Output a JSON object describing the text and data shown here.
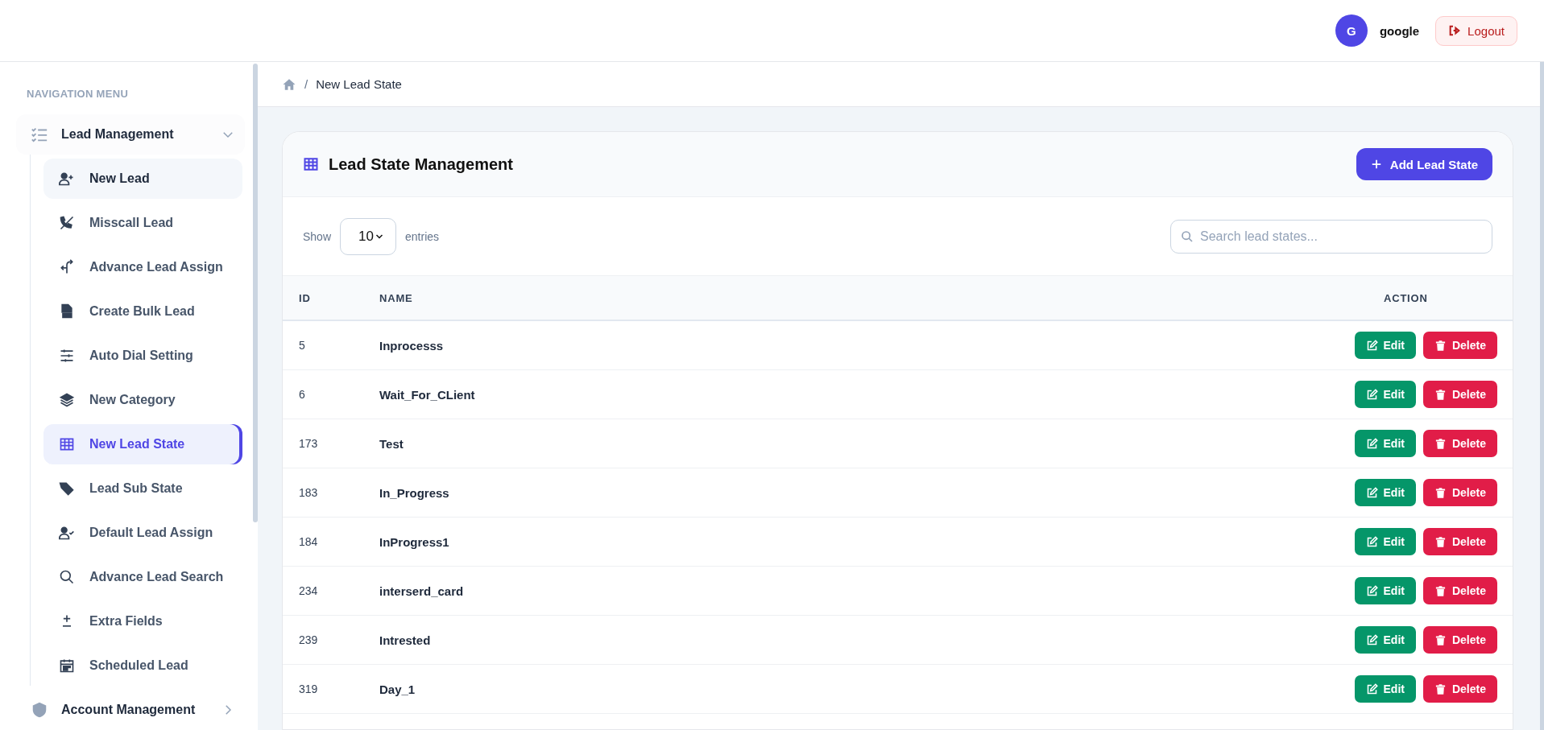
{
  "header": {
    "avatar": "G",
    "user": "google",
    "logout": "Logout"
  },
  "sidebar": {
    "heading": "NAVIGATION MENU",
    "groups": [
      {
        "label": "Lead Management",
        "expanded": true,
        "children": [
          {
            "label": "New Lead",
            "selected": false,
            "hovered": true
          },
          {
            "label": "Misscall Lead",
            "selected": false,
            "hovered": false
          },
          {
            "label": "Advance Lead Assign",
            "selected": false,
            "hovered": false
          },
          {
            "label": "Create Bulk Lead",
            "selected": false,
            "hovered": false
          },
          {
            "label": "Auto Dial Setting",
            "selected": false,
            "hovered": false
          },
          {
            "label": "New Category",
            "selected": false,
            "hovered": false
          },
          {
            "label": "New Lead State",
            "selected": true,
            "hovered": false
          },
          {
            "label": "Lead Sub State",
            "selected": false,
            "hovered": false
          },
          {
            "label": "Default Lead Assign",
            "selected": false,
            "hovered": false
          },
          {
            "label": "Advance Lead Search",
            "selected": false,
            "hovered": false
          },
          {
            "label": "Extra Fields",
            "selected": false,
            "hovered": false
          },
          {
            "label": "Scheduled Lead",
            "selected": false,
            "hovered": false
          }
        ]
      },
      {
        "label": "Account Management",
        "expanded": false
      }
    ]
  },
  "breadcrumb": {
    "separator": "/",
    "current": "New Lead State"
  },
  "card": {
    "title": "Lead State Management",
    "add_button": "Add Lead State",
    "show_label": "Show",
    "page_size": "10",
    "entries_label": "entries",
    "search": {
      "placeholder": "Search lead states..."
    },
    "table": {
      "columns": [
        "ID",
        "NAME",
        "ACTION"
      ],
      "rows": [
        {
          "id": "5",
          "name": "Inprocesss",
          "edit": "Edit",
          "delete": "Delete"
        },
        {
          "id": "6",
          "name": "Wait_For_CLient",
          "edit": "Edit",
          "delete": "Delete"
        },
        {
          "id": "173",
          "name": "Test",
          "edit": "Edit",
          "delete": "Delete"
        },
        {
          "id": "183",
          "name": "In_Progress",
          "edit": "Edit",
          "delete": "Delete"
        },
        {
          "id": "184",
          "name": "InProgress1",
          "edit": "Edit",
          "delete": "Delete"
        },
        {
          "id": "234",
          "name": "interserd_card",
          "edit": "Edit",
          "delete": "Delete"
        },
        {
          "id": "239",
          "name": "Intrested",
          "edit": "Edit",
          "delete": "Delete"
        },
        {
          "id": "319",
          "name": "Day_1",
          "edit": "Edit",
          "delete": "Delete"
        }
      ]
    }
  }
}
